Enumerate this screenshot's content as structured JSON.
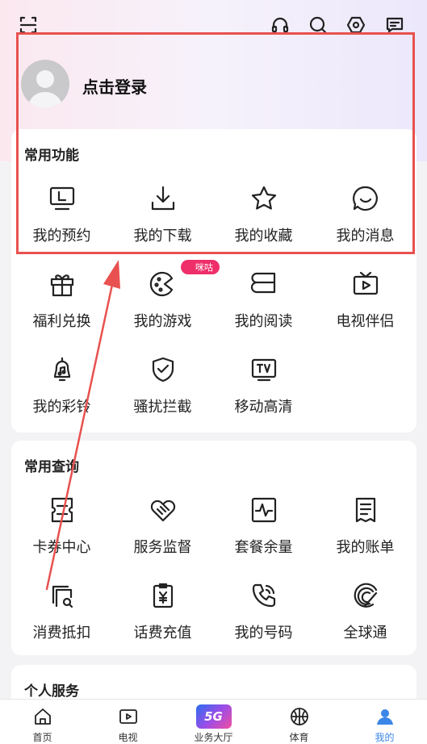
{
  "profile": {
    "login_label": "点击登录"
  },
  "common_functions": {
    "title": "常用功能",
    "items": [
      {
        "label": "我的预约",
        "icon": "tv-reserve-icon"
      },
      {
        "label": "我的下载",
        "icon": "download-icon"
      },
      {
        "label": "我的收藏",
        "icon": "star-icon"
      },
      {
        "label": "我的消息",
        "icon": "message-smile-icon"
      },
      {
        "label": "福利兑换",
        "icon": "gift-icon"
      },
      {
        "label": "我的游戏",
        "icon": "game-palette-icon"
      },
      {
        "label": "我的阅读",
        "icon": "book-icon"
      },
      {
        "label": "电视伴侣",
        "icon": "tv-icon"
      },
      {
        "label": "我的彩铃",
        "icon": "bell-music-icon"
      },
      {
        "label": "骚扰拦截",
        "icon": "shield-check-icon"
      },
      {
        "label": "移动高清",
        "icon": "tv-hd-icon"
      }
    ],
    "badge": "咪咕"
  },
  "common_queries": {
    "title": "常用查询",
    "items": [
      {
        "label": "卡券中心",
        "icon": "coupon-icon"
      },
      {
        "label": "服务监督",
        "icon": "handshake-heart-icon"
      },
      {
        "label": "套餐余量",
        "icon": "pulse-chart-icon"
      },
      {
        "label": "我的账单",
        "icon": "bill-icon"
      },
      {
        "label": "消费抵扣",
        "icon": "copy-search-icon"
      },
      {
        "label": "话费充值",
        "icon": "yen-clipboard-icon"
      },
      {
        "label": "我的号码",
        "icon": "phone-icon"
      },
      {
        "label": "全球通",
        "icon": "globe-swirl-icon"
      }
    ]
  },
  "personal_services": {
    "title": "个人服务"
  },
  "tabbar": [
    {
      "label": "首页",
      "icon": "home-icon"
    },
    {
      "label": "电视",
      "icon": "video-play-icon"
    },
    {
      "label": "业务大厅",
      "icon": "5g-logo-icon"
    },
    {
      "label": "体育",
      "icon": "basketball-icon"
    },
    {
      "label": "我的",
      "icon": "user-icon"
    }
  ],
  "colors": {
    "accent": "#3b86e6",
    "highlight_border": "#e8514f",
    "badge": "#ef2f6a"
  }
}
